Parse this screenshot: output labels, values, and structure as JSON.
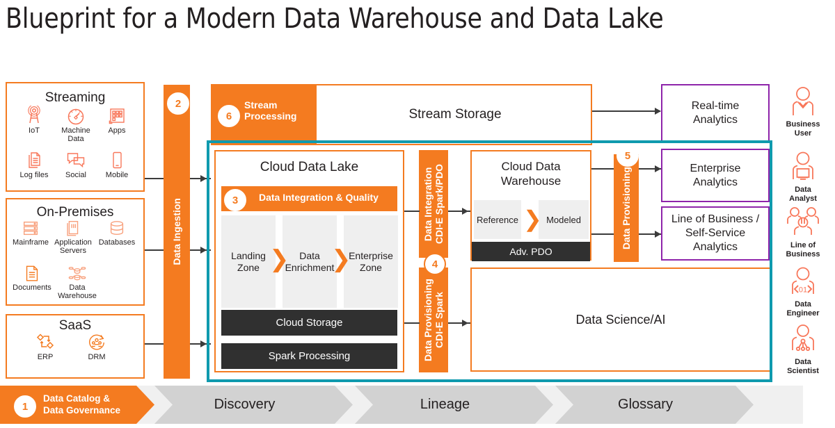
{
  "title": "Blueprint for a Modern Data Warehouse and Data Lake",
  "colors": {
    "orange": "#f47b20",
    "orange_light": "#f8a07c",
    "teal": "#0f9aae",
    "purple": "#8e24aa",
    "dark": "#303030",
    "gray_zone": "#efefef",
    "gray_chevron": "#d0d0d0",
    "text": "#231f20"
  },
  "sources": {
    "streaming": {
      "title": "Streaming",
      "items": [
        {
          "label": "IoT",
          "icon": "iot-antenna-icon"
        },
        {
          "label": "Machine\nData",
          "icon": "gauge-icon"
        },
        {
          "label": "Apps",
          "icon": "apps-grid-icon"
        },
        {
          "label": "Log files",
          "icon": "documents-stack-icon"
        },
        {
          "label": "Social",
          "icon": "chat-bubbles-icon"
        },
        {
          "label": "Mobile",
          "icon": "mobile-phone-icon"
        }
      ]
    },
    "on_premises": {
      "title": "On-Premises",
      "items": [
        {
          "label": "Mainframe",
          "icon": "mainframe-servers-icon"
        },
        {
          "label": "Application\nServers",
          "icon": "application-servers-icon"
        },
        {
          "label": "Databases",
          "icon": "database-cylinder-icon"
        },
        {
          "label": "Documents",
          "icon": "document-page-icon"
        },
        {
          "label": "Data\nWarehouse",
          "icon": "data-warehouse-nodes-icon"
        }
      ]
    },
    "saas": {
      "title": "SaaS",
      "items": [
        {
          "label": "ERP",
          "icon": "erp-flow-icon"
        },
        {
          "label": "DRM",
          "icon": "drm-people-cycle-icon"
        }
      ]
    }
  },
  "ingestion": {
    "badge": "2",
    "label": "Data Ingestion"
  },
  "stream": {
    "badge": "6",
    "processing_label": "Stream\nProcessing",
    "storage_label": "Stream Storage"
  },
  "data_lake": {
    "title": "Cloud Data Lake",
    "integration_badge": "3",
    "integration_label": "Data Integration & Quality",
    "zones": [
      "Landing\nZone",
      "Data\nEnrichment",
      "Enterprise\nZone"
    ],
    "storage_label": "Cloud Storage",
    "spark_label": "Spark Processing"
  },
  "middle_bars": {
    "badge": "4",
    "top_label": "Data Integration\nCDI-E Spark/PDO",
    "bottom_label": "Data Provisioning\nCDI-E Spark"
  },
  "warehouse": {
    "title": "Cloud Data\nWarehouse",
    "zones": [
      "Reference",
      "Modeled"
    ],
    "pdo_label": "Adv. PDO"
  },
  "data_science": {
    "label": "Data Science/AI"
  },
  "provisioning": {
    "badge": "5",
    "label": "Data Provisioning"
  },
  "consumers": [
    {
      "label": "Real-time\nAnalytics"
    },
    {
      "label": "Enterprise\nAnalytics"
    },
    {
      "label": "Line of Business /\nSelf-Service\nAnalytics"
    }
  ],
  "personas": [
    {
      "label": "Business\nUser",
      "icon": "business-user-icon"
    },
    {
      "label": "Data\nAnalyst",
      "icon": "data-analyst-icon"
    },
    {
      "label": "Line of\nBusiness",
      "icon": "line-of-business-icon"
    },
    {
      "label": "Data\nEngineer",
      "icon": "data-engineer-icon"
    },
    {
      "label": "Data\nScientist",
      "icon": "data-scientist-icon"
    }
  ],
  "governance": {
    "badge": "1",
    "primary_label": "Data Catalog &\nData Governance",
    "steps": [
      "Discovery",
      "Lineage",
      "Glossary"
    ]
  }
}
